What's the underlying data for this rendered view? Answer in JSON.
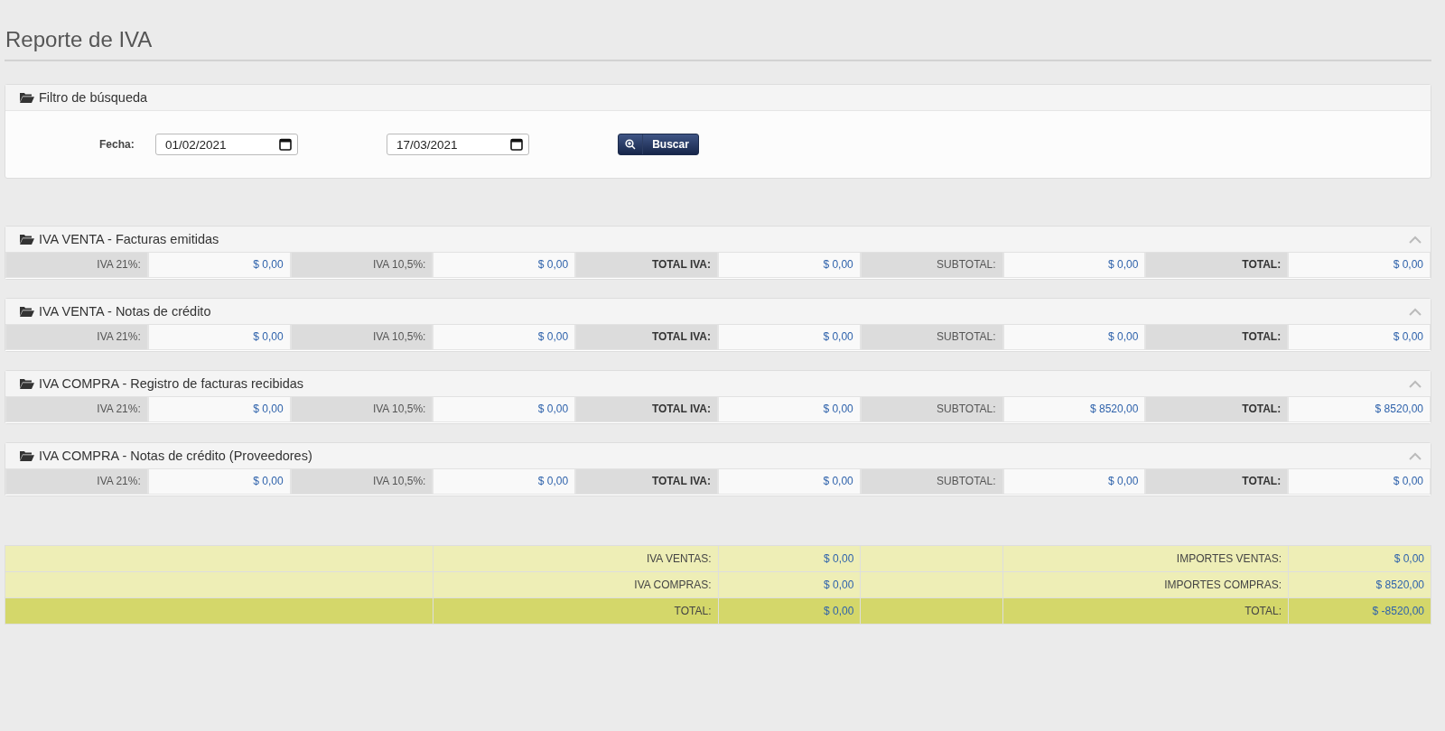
{
  "page_title": "Reporte de IVA",
  "filter": {
    "title": "Filtro de búsqueda",
    "date_label": "Fecha:",
    "date_from": "01/02/2021",
    "date_to": "17/03/2021",
    "search_button": "Buscar"
  },
  "sections": [
    {
      "title": "IVA VENTA - Facturas emitidas",
      "expanded": true,
      "cells": [
        {
          "label": "IVA 21%:",
          "bold": false,
          "value": "$ 0,00"
        },
        {
          "label": "IVA 10,5%:",
          "bold": false,
          "value": "$ 0,00"
        },
        {
          "label": "TOTAL IVA:",
          "bold": true,
          "value": "$ 0,00"
        },
        {
          "label": "SUBTOTAL:",
          "bold": false,
          "value": "$ 0,00"
        },
        {
          "label": "TOTAL:",
          "bold": true,
          "value": "$ 0,00"
        }
      ]
    },
    {
      "title": "IVA VENTA - Notas de crédito",
      "expanded": true,
      "cells": [
        {
          "label": "IVA 21%:",
          "bold": false,
          "value": "$ 0,00"
        },
        {
          "label": "IVA 10,5%:",
          "bold": false,
          "value": "$ 0,00"
        },
        {
          "label": "TOTAL IVA:",
          "bold": true,
          "value": "$ 0,00"
        },
        {
          "label": "SUBTOTAL:",
          "bold": false,
          "value": "$ 0,00"
        },
        {
          "label": "TOTAL:",
          "bold": true,
          "value": "$ 0,00"
        }
      ]
    },
    {
      "title": "IVA COMPRA - Registro de facturas recibidas",
      "expanded": true,
      "cells": [
        {
          "label": "IVA 21%:",
          "bold": false,
          "value": "$ 0,00"
        },
        {
          "label": "IVA 10,5%:",
          "bold": false,
          "value": "$ 0,00"
        },
        {
          "label": "TOTAL IVA:",
          "bold": true,
          "value": "$ 0,00"
        },
        {
          "label": "SUBTOTAL:",
          "bold": false,
          "value": "$ 8520,00"
        },
        {
          "label": "TOTAL:",
          "bold": true,
          "value": "$ 8520,00"
        }
      ]
    },
    {
      "title": "IVA COMPRA - Notas de crédito (Proveedores)",
      "expanded": true,
      "cells": [
        {
          "label": "IVA 21%:",
          "bold": false,
          "value": "$ 0,00"
        },
        {
          "label": "IVA 10,5%:",
          "bold": false,
          "value": "$ 0,00"
        },
        {
          "label": "TOTAL IVA:",
          "bold": true,
          "value": "$ 0,00"
        },
        {
          "label": "SUBTOTAL:",
          "bold": false,
          "value": "$ 0,00"
        },
        {
          "label": "TOTAL:",
          "bold": true,
          "value": "$ 0,00"
        }
      ]
    }
  ],
  "summary": [
    {
      "kind": "normal",
      "iva_label": "IVA VENTAS:",
      "iva_value": "$ 0,00",
      "amount_label": "IMPORTES VENTAS:",
      "amount_value": "$ 0,00"
    },
    {
      "kind": "normal",
      "iva_label": "IVA COMPRAS:",
      "iva_value": "$ 0,00",
      "amount_label": "IMPORTES COMPRAS:",
      "amount_value": "$ 8520,00"
    },
    {
      "kind": "total",
      "iva_label": "TOTAL:",
      "iva_value": "$ 0,00",
      "amount_label": "TOTAL:",
      "amount_value": "$ -8520,00"
    }
  ]
}
